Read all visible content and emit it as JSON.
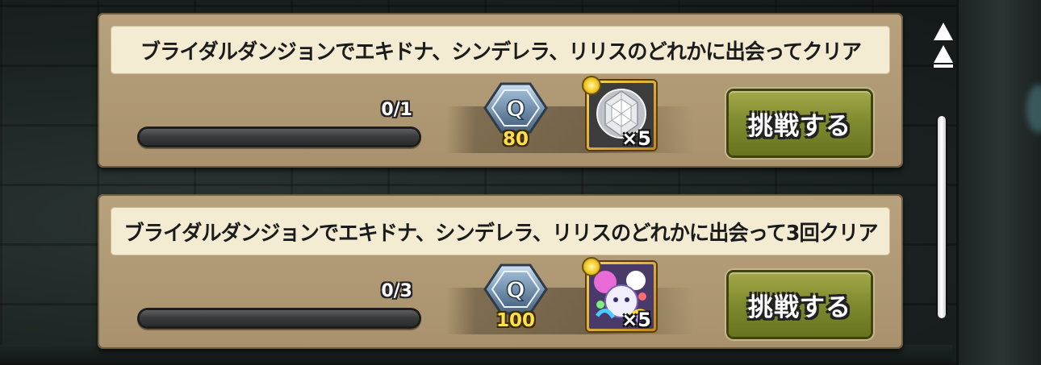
{
  "missions": [
    {
      "title": "ブライダルダンジョンでエキドナ、シンデレラ、リリスのどれかに出会ってクリア",
      "progress_text": "0/1",
      "progress_fraction": 0,
      "quest_points": "80",
      "reward_qty": "×5",
      "reward_icon": "silver-gem-icon",
      "button_label": "挑戦する"
    },
    {
      "title": "ブライダルダンジョンでエキドナ、シンデレラ、リリスのどれかに出会って3回クリア",
      "progress_text": "0/3",
      "progress_fraction": 0,
      "quest_points": "100",
      "reward_qty": "×5",
      "reward_icon": "rainbow-monster-icon",
      "button_label": "挑戦する"
    }
  ],
  "quest_badge_letter": "Q",
  "colors": {
    "card_bg": "#b8a27e",
    "button_green": "#7e8a2d",
    "points_yellow": "#ffe04a"
  }
}
